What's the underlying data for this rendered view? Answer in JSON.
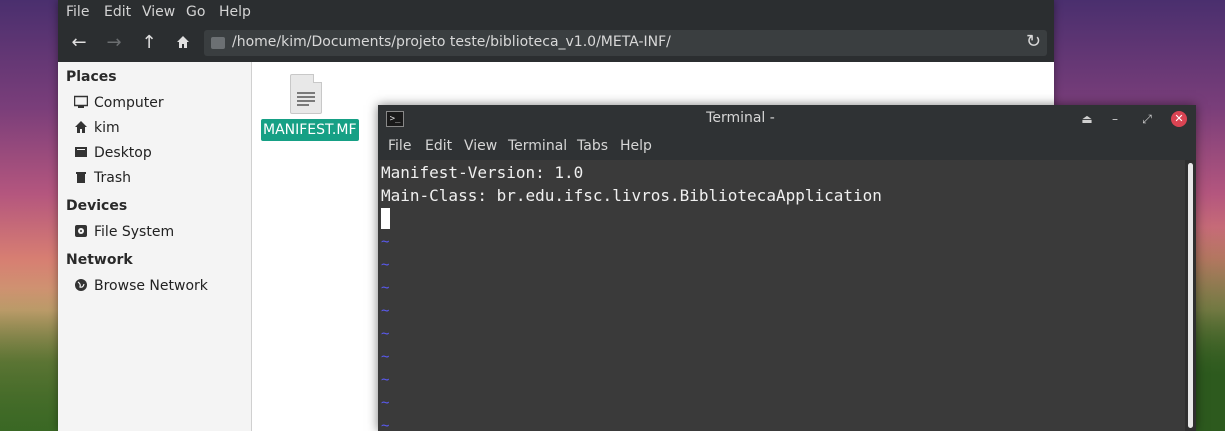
{
  "file_manager": {
    "menu": [
      "File",
      "Edit",
      "View",
      "Go",
      "Help"
    ],
    "location_path": "/home/kim/Documents/projeto teste/biblioteca_v1.0/META-INF/",
    "sidebar": {
      "places_header": "Places",
      "places": [
        "Computer",
        "kim",
        "Desktop",
        "Trash"
      ],
      "devices_header": "Devices",
      "devices": [
        "File System"
      ],
      "network_header": "Network",
      "network": [
        "Browse Network"
      ]
    },
    "files": [
      {
        "name": "MANIFEST.MF",
        "icon": "text-file-icon",
        "selected": true
      }
    ],
    "selection_color": "#16a085"
  },
  "terminal": {
    "title": "Terminal -",
    "menu": [
      "File",
      "Edit",
      "View",
      "Terminal",
      "Tabs",
      "Help"
    ],
    "lines": [
      "Manifest-Version: 1.0",
      "Main-Class: br.edu.ifsc.livros.BibliotecaApplication"
    ],
    "tilde_char": "~",
    "close_color": "#da4453"
  }
}
